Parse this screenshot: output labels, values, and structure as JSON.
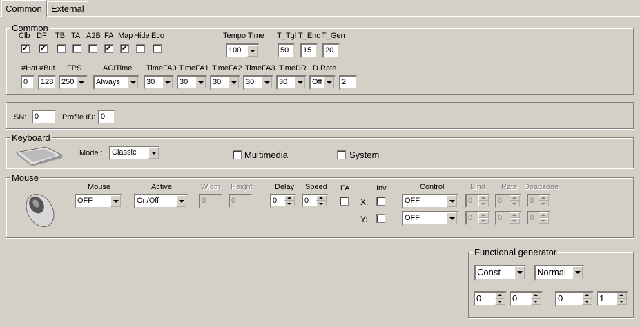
{
  "tabs": [
    {
      "label": "Common"
    },
    {
      "label": "External"
    }
  ],
  "common": {
    "title": "Common",
    "checks": [
      {
        "label": "Clb",
        "checked": true
      },
      {
        "label": "DF",
        "checked": true
      },
      {
        "label": "TB",
        "checked": false
      },
      {
        "label": "TA",
        "checked": false
      },
      {
        "label": "A2B",
        "checked": false
      },
      {
        "label": "FA",
        "checked": true
      },
      {
        "label": "Map",
        "checked": true
      },
      {
        "label": "Hide",
        "checked": false
      },
      {
        "label": "Eco",
        "checked": false
      }
    ],
    "tempo_time_label": "Tempo Time",
    "tempo_time_value": "100",
    "t_tgl_label": "T_Tgl",
    "t_tgl_value": "50",
    "t_enc_label": "T_Enc",
    "t_enc_value": "15",
    "t_gen_label": "T_Gen",
    "t_gen_value": "20",
    "hat_label": "#Hat",
    "hat_value": "0",
    "but_label": "#But",
    "but_value": "128",
    "fps_label": "FPS",
    "fps_value": "250",
    "acitime_label": "ACITime",
    "acitime_value": "Always",
    "timefa0_label": "TimeFA0",
    "timefa0_value": "30",
    "timefa1_label": "TimeFA1",
    "timefa1_value": "30",
    "timefa2_label": "TimeFA2",
    "timefa2_value": "30",
    "timefa3_label": "TimeFA3",
    "timefa3_value": "30",
    "timedr_label": "TimeDR",
    "timedr_value": "30",
    "drate_label": "D.Rate",
    "drate_value": "Off",
    "drate_num": "2"
  },
  "sn": {
    "label": "SN:",
    "value": "0",
    "profile_label": "Profile ID:",
    "profile_value": "0"
  },
  "keyboard": {
    "title": "Keyboard",
    "mode_label": "Mode :",
    "mode_value": "Classic",
    "multimedia_label": "Multimedia",
    "system_label": "System"
  },
  "mouse": {
    "title": "Mouse",
    "mouse_label": "Mouse",
    "mouse_value": "OFF",
    "active_label": "Active",
    "active_value": "On/Off",
    "width_label": "Width",
    "width_value": "0",
    "height_label": "Height",
    "height_value": "0",
    "delay_label": "Delay",
    "delay_value": "0",
    "speed_label": "Speed",
    "speed_value": "0",
    "fa_label": "FA",
    "inv_label": "Inv",
    "x_label": "X:",
    "y_label": "Y:",
    "control_label": "Control",
    "control_x": "OFF",
    "control_y": "OFF",
    "bind_label": "Bind",
    "rate_label": "Rate",
    "deadzone_label": "Deadzone",
    "bind_x": "0",
    "rate_x": "0",
    "dead_x": "0",
    "bind_y": "0",
    "rate_y": "0",
    "dead_y": "0"
  },
  "generator": {
    "title": "Functional generator",
    "type_value": "Const",
    "mode_value": "Normal",
    "v1": "0",
    "v2": "0",
    "v3": "0",
    "v4": "1"
  }
}
